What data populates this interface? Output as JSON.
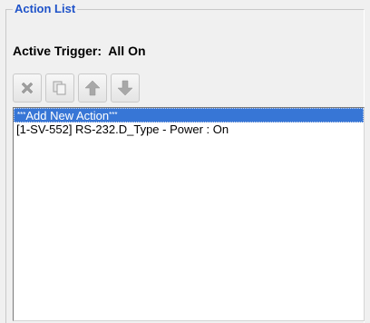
{
  "group": {
    "title": "Action List"
  },
  "trigger": {
    "label": "Active Trigger:",
    "value": "All On"
  },
  "toolbar": {
    "buttons": [
      {
        "icon": "delete-icon"
      },
      {
        "icon": "copy-icon"
      },
      {
        "icon": "arrow-up-icon"
      },
      {
        "icon": "arrow-down-icon"
      }
    ]
  },
  "list": {
    "items": [
      {
        "prefix": "***",
        "text": "Add New Action",
        "suffix": "***",
        "selected": true
      },
      {
        "text": "[1-SV-552] RS-232.D_Type - Power : On",
        "selected": false
      }
    ]
  },
  "colors": {
    "title": "#1f53c9",
    "selection": "#3776d6",
    "icon_gray": "#a8a8a8"
  }
}
